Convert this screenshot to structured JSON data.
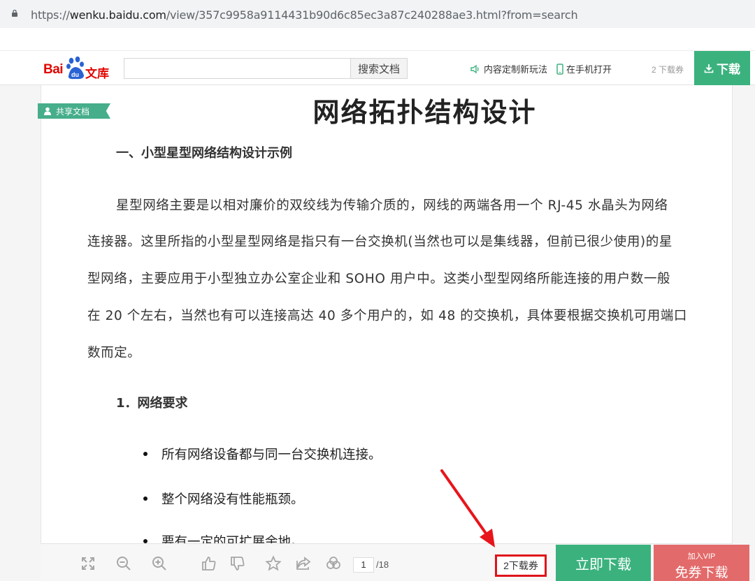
{
  "browser": {
    "url_prefix": "https://",
    "url_domain": "wenku.baidu.com",
    "url_path": "/view/357c9958a9114431b90d6c85ec3a87c240288ae3.html?from=search"
  },
  "header": {
    "logo_bai": "Bai",
    "logo_du": "du",
    "logo_wenku": "文库",
    "search_placeholder": "",
    "search_button": "搜索文档",
    "custom_link": "内容定制新玩法",
    "mobile_link": "在手机打开",
    "vouchers": "2 下载券",
    "download_button": "下载",
    "accent": "#3bb27e"
  },
  "document": {
    "shared_tag": "共享文档",
    "title": "网络拓扑结构设计",
    "heading1": "一、小型星型网络结构设计示例",
    "paragraph_lines": [
      "星型网络主要是以相对廉价的双绞线为传输介质的，网线的两端各用一个 RJ-45 水晶头为网络",
      "连接器。这里所指的小型星型网络是指只有一台交换机(当然也可以是集线器，但前已很少使用)的星",
      "型网络，主要应用于小型独立办公室企业和 SOHO 用户中。这类小型型网络所能连接的用户数一般",
      "在 20 个左右，当然也有可以连接高达 40 多个用户的，如 48 的交换机，具体要根据交换机可用端口",
      "数而定。"
    ],
    "heading2": "1．网络要求",
    "bullets": [
      "所有网络设备都与同一台交换机连接。",
      "整个网络没有性能瓶颈。",
      "要有一定的可扩展余地。"
    ]
  },
  "toolbar": {
    "icons": [
      "fullscreen-icon",
      "zoom-out-icon",
      "zoom-in-icon",
      "thumbs-up-icon",
      "thumbs-down-icon",
      "star-icon",
      "share-icon",
      "link-icon"
    ],
    "page_current": "1",
    "page_total": "/18",
    "voucher_button": "2下载券",
    "now_download": "立即下载",
    "vip_small": "加入VIP",
    "vip_big": "免券下载",
    "vip_color": "#e36a6a",
    "highlight_color": "#e0131b"
  }
}
